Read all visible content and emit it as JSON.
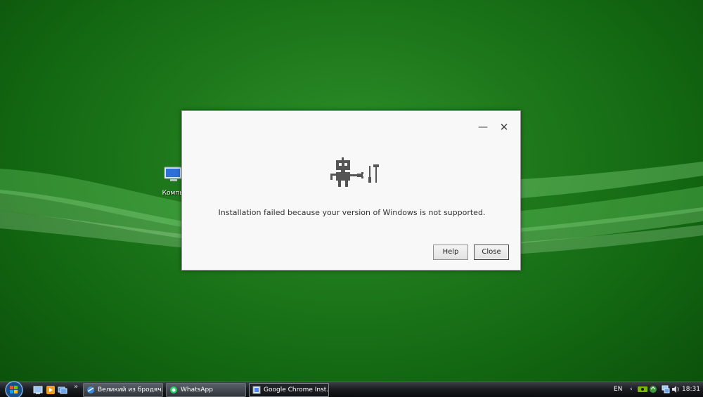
{
  "desktop": {
    "icons": [
      {
        "label": "Компьют"
      }
    ]
  },
  "dialog": {
    "message": "Installation failed because your version of Windows is not supported.",
    "minimize_glyph": "—",
    "close_glyph": "✕",
    "buttons": {
      "help": "Help",
      "close": "Close"
    },
    "icon": "robot-repair-icon"
  },
  "taskbar": {
    "quick_launch": [
      "show-desktop-icon",
      "media-player-icon",
      "switch-windows-icon"
    ],
    "overflow_glyph": "»",
    "tasks": [
      {
        "label": "Великий из бродяч...",
        "icon": "browser-icon"
      },
      {
        "label": "WhatsApp",
        "icon": "whatsapp-icon"
      },
      {
        "label": "Google Chrome Inst...",
        "icon": "installer-icon",
        "active": true
      }
    ],
    "tray": {
      "language": "EN",
      "expand_glyph": "‹",
      "icons": [
        "nvidia-icon",
        "network-icon",
        "volume-icon"
      ],
      "time": "18:31"
    }
  },
  "colors": {
    "desktop_green": "#1f7a1c",
    "dialog_bg": "#f8f8f8",
    "robot_gray": "#555555"
  }
}
